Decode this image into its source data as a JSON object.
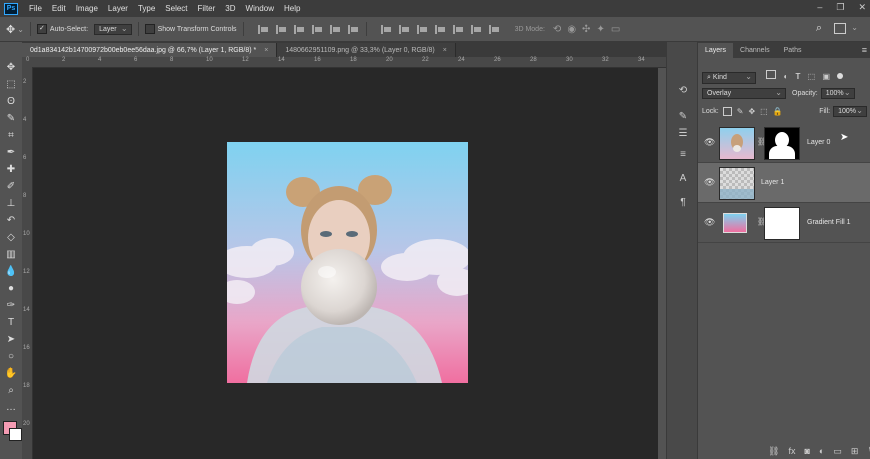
{
  "app": {
    "logo": "Ps"
  },
  "menu": [
    "File",
    "Edit",
    "Image",
    "Layer",
    "Type",
    "Select",
    "Filter",
    "3D",
    "Window",
    "Help"
  ],
  "window_controls": [
    "–",
    "❐",
    "✕"
  ],
  "options": {
    "auto_select_label": "Auto-Select:",
    "auto_select_value": "Layer",
    "show_transform_label": "Show Transform Controls",
    "mode_3d_label": "3D Mode:"
  },
  "tabs": [
    {
      "label": "0d1a834142b14700972b00eb0ee56daa.jpg @ 66,7% (Layer 1, RGB/8) *",
      "close": "×"
    },
    {
      "label": "1480662951109.png @ 33,3% (Layer 0, RGB/8)",
      "close": "×"
    }
  ],
  "rulers": {
    "top": [
      "0",
      "2",
      "4",
      "6",
      "8",
      "10",
      "12",
      "14",
      "16",
      "18",
      "20",
      "22",
      "24",
      "26",
      "28",
      "30",
      "32",
      "34"
    ],
    "left": [
      "2",
      "4",
      "6",
      "8",
      "10",
      "12",
      "14",
      "16",
      "18",
      "20"
    ]
  },
  "layers_panel": {
    "tabs": [
      "Layers",
      "Channels",
      "Paths"
    ],
    "kind_label": "Kind",
    "blend_mode": "Overlay",
    "opacity_label": "Opacity:",
    "opacity_value": "100%",
    "lock_label": "Lock:",
    "fill_label": "Fill:",
    "fill_value": "100%",
    "layers": [
      {
        "name": "Layer 0",
        "selected": false
      },
      {
        "name": "Layer 1",
        "selected": true
      },
      {
        "name": "Gradient Fill 1",
        "selected": false
      }
    ]
  },
  "colors": {
    "foreground": "#f59bb3",
    "background": "#ffffff",
    "accent": "#31a8ff"
  }
}
